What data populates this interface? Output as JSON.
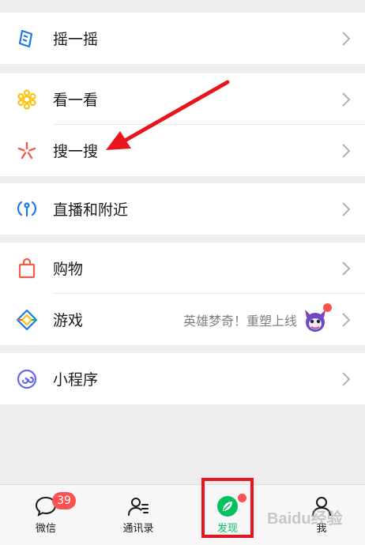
{
  "menu": {
    "shake_label": "摇一摇",
    "look_label": "看一看",
    "search_label": "搜一搜",
    "live_nearby_label": "直播和附近",
    "shopping_label": "购物",
    "games_label": "游戏",
    "games_promo_text": "英雄梦奇！重塑上线",
    "miniprogram_label": "小程序"
  },
  "tabbar": {
    "chats_label": "微信",
    "chats_badge": "39",
    "contacts_label": "通讯录",
    "discover_label": "发现",
    "me_label": "我"
  },
  "watermark": "Baidu经验",
  "colors": {
    "accent_green": "#07c160",
    "badge_red": "#fa5151",
    "annotation_red": "#e8141e"
  }
}
